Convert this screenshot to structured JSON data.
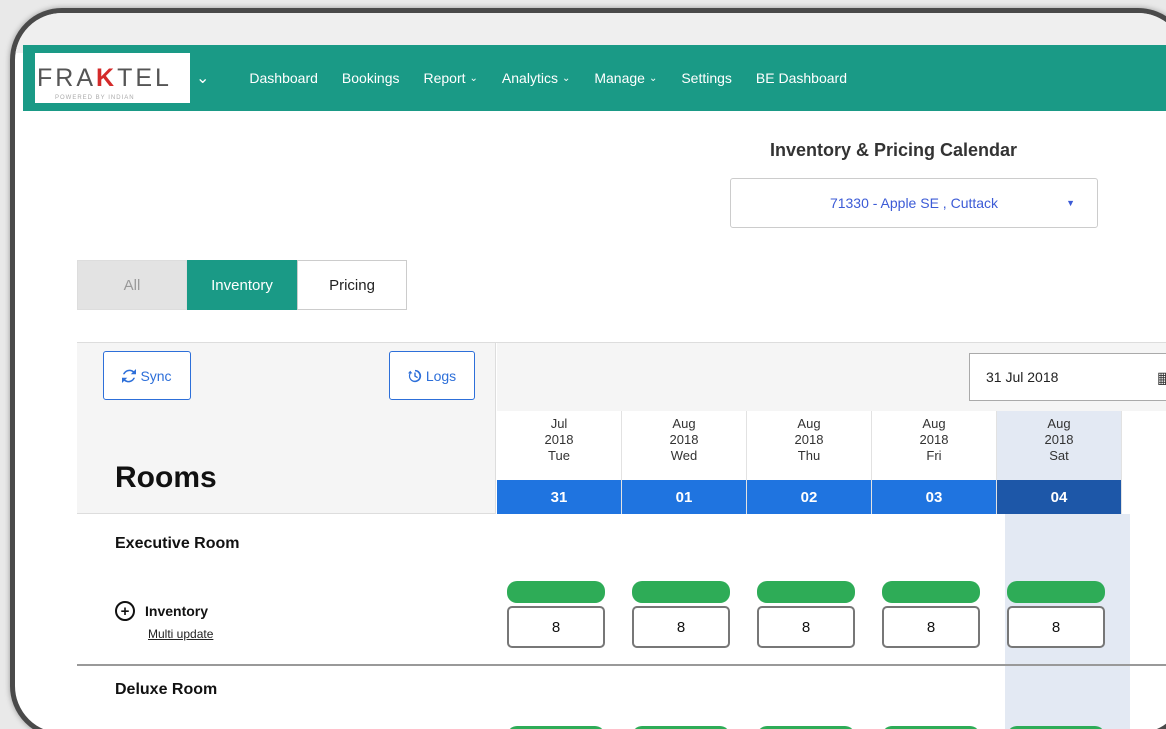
{
  "nav": {
    "logo_prefix": "FRA",
    "logo_k": "K",
    "logo_suffix": "TEL",
    "logo_sub": "POWERED BY INDIAN",
    "items": [
      {
        "label": "Dashboard",
        "dropdown": false
      },
      {
        "label": "Bookings",
        "dropdown": false
      },
      {
        "label": "Report",
        "dropdown": true
      },
      {
        "label": "Analytics",
        "dropdown": true
      },
      {
        "label": "Manage",
        "dropdown": true
      },
      {
        "label": "Settings",
        "dropdown": false
      },
      {
        "label": "BE Dashboard",
        "dropdown": false
      }
    ]
  },
  "page": {
    "title": "Inventory & Pricing Calendar",
    "property_selected": "71330 - Apple SE , Cuttack"
  },
  "view_toggle": {
    "all": "All",
    "inventory": "Inventory",
    "pricing": "Pricing",
    "active": "Inventory"
  },
  "toolbar": {
    "sync_label": "Sync",
    "logs_label": "Logs",
    "date_value": "31 Jul 2018"
  },
  "rooms_title": "Rooms",
  "days": [
    {
      "month": "Jul",
      "year": "2018",
      "dow": "Tue",
      "day": "31",
      "weekend": false
    },
    {
      "month": "Aug",
      "year": "2018",
      "dow": "Wed",
      "day": "01",
      "weekend": false
    },
    {
      "month": "Aug",
      "year": "2018",
      "dow": "Thu",
      "day": "02",
      "weekend": false
    },
    {
      "month": "Aug",
      "year": "2018",
      "dow": "Fri",
      "day": "03",
      "weekend": false
    },
    {
      "month": "Aug",
      "year": "2018",
      "dow": "Sat",
      "day": "04",
      "weekend": true
    }
  ],
  "rooms": [
    {
      "name": "Executive Room",
      "inventory_label": "Inventory",
      "multi_update_label": "Multi update",
      "inventory": [
        "8",
        "8",
        "8",
        "8",
        "8"
      ]
    },
    {
      "name": "Deluxe Room"
    }
  ],
  "colors": {
    "brand": "#1a9a86",
    "date_header": "#1f74e0",
    "weekend_header": "#1d57a8",
    "available": "#2eac57"
  }
}
